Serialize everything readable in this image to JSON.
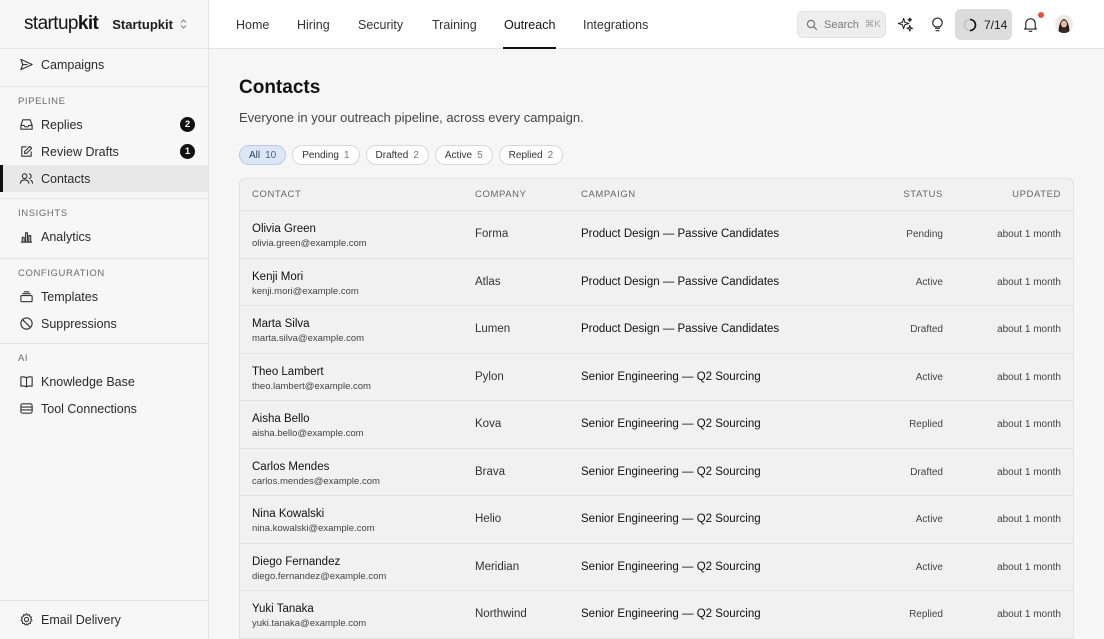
{
  "brand": {
    "logo_light": "startup",
    "logo_bold": "kit",
    "workspace": "Startupkit"
  },
  "sidebar": {
    "top_item": {
      "label": "Campaigns",
      "icon": "send-icon"
    },
    "sections": [
      {
        "label": "PIPELINE",
        "items": [
          {
            "label": "Replies",
            "icon": "inbox-icon",
            "badge": "2"
          },
          {
            "label": "Review Drafts",
            "icon": "edit-icon",
            "badge": "1"
          },
          {
            "label": "Contacts",
            "icon": "users-icon",
            "active": true
          }
        ]
      },
      {
        "label": "INSIGHTS",
        "items": [
          {
            "label": "Analytics",
            "icon": "bar-chart-icon"
          }
        ]
      },
      {
        "label": "CONFIGURATION",
        "items": [
          {
            "label": "Templates",
            "icon": "layers-icon"
          },
          {
            "label": "Suppressions",
            "icon": "ban-icon"
          }
        ]
      },
      {
        "label": "AI",
        "items": [
          {
            "label": "Knowledge Base",
            "icon": "book-icon"
          },
          {
            "label": "Tool Connections",
            "icon": "database-icon"
          }
        ]
      }
    ],
    "bottom_item": {
      "label": "Email Delivery",
      "icon": "gear-icon"
    }
  },
  "topbar": {
    "tabs": [
      {
        "label": "Home"
      },
      {
        "label": "Hiring"
      },
      {
        "label": "Security"
      },
      {
        "label": "Training"
      },
      {
        "label": "Outreach",
        "active": true
      },
      {
        "label": "Integrations"
      }
    ],
    "search": {
      "placeholder": "Search",
      "shortcut": "⌘K"
    },
    "progress": {
      "label": "7/14",
      "done": 7,
      "total": 14
    },
    "notification_dot_color": "#e5533d"
  },
  "page": {
    "title": "Contacts",
    "subtitle": "Everyone in your outreach pipeline, across every campaign."
  },
  "filters": [
    {
      "label": "All",
      "count": "10",
      "active": true
    },
    {
      "label": "Pending",
      "count": "1"
    },
    {
      "label": "Drafted",
      "count": "2"
    },
    {
      "label": "Active",
      "count": "5"
    },
    {
      "label": "Replied",
      "count": "2"
    }
  ],
  "table": {
    "columns": {
      "contact": "CONTACT",
      "company": "COMPANY",
      "campaign": "CAMPAIGN",
      "status": "STATUS",
      "updated": "UPDATED"
    },
    "rows": [
      {
        "name": "Olivia Green",
        "email": "olivia.green@example.com",
        "company": "Forma",
        "campaign": "Product Design — Passive Candidates",
        "status": "Pending",
        "updated": "about 1 month"
      },
      {
        "name": "Kenji Mori",
        "email": "kenji.mori@example.com",
        "company": "Atlas",
        "campaign": "Product Design — Passive Candidates",
        "status": "Active",
        "updated": "about 1 month"
      },
      {
        "name": "Marta Silva",
        "email": "marta.silva@example.com",
        "company": "Lumen",
        "campaign": "Product Design — Passive Candidates",
        "status": "Drafted",
        "updated": "about 1 month"
      },
      {
        "name": "Theo Lambert",
        "email": "theo.lambert@example.com",
        "company": "Pylon",
        "campaign": "Senior Engineering — Q2 Sourcing",
        "status": "Active",
        "updated": "about 1 month"
      },
      {
        "name": "Aisha Bello",
        "email": "aisha.bello@example.com",
        "company": "Kova",
        "campaign": "Senior Engineering — Q2 Sourcing",
        "status": "Replied",
        "updated": "about 1 month"
      },
      {
        "name": "Carlos Mendes",
        "email": "carlos.mendes@example.com",
        "company": "Brava",
        "campaign": "Senior Engineering — Q2 Sourcing",
        "status": "Drafted",
        "updated": "about 1 month"
      },
      {
        "name": "Nina Kowalski",
        "email": "nina.kowalski@example.com",
        "company": "Helio",
        "campaign": "Senior Engineering — Q2 Sourcing",
        "status": "Active",
        "updated": "about 1 month"
      },
      {
        "name": "Diego Fernandez",
        "email": "diego.fernandez@example.com",
        "company": "Meridian",
        "campaign": "Senior Engineering — Q2 Sourcing",
        "status": "Active",
        "updated": "about 1 month"
      },
      {
        "name": "Yuki Tanaka",
        "email": "yuki.tanaka@example.com",
        "company": "Northwind",
        "campaign": "Senior Engineering — Q2 Sourcing",
        "status": "Replied",
        "updated": "about 1 month"
      }
    ]
  }
}
